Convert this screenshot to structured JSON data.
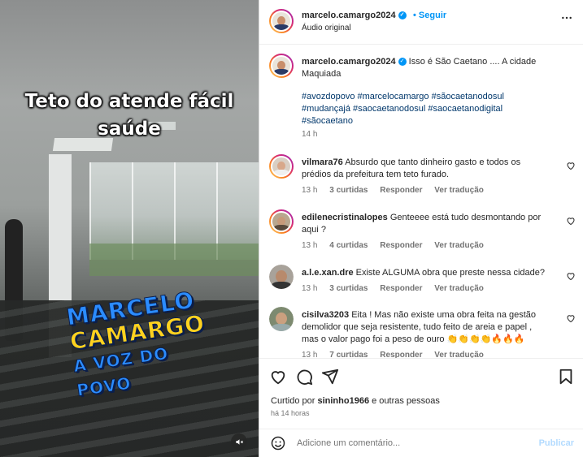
{
  "media": {
    "caption_line1": "Teto do atende fácil",
    "caption_line2": "saúde",
    "logo_line1": "MARCELO",
    "logo_line2": "CAMARGO",
    "logo_line3": "A VOZ DO POVO",
    "mute_icon": "muted-speaker-icon"
  },
  "header": {
    "username": "marcelo.camargo2024",
    "follow_separator": "•",
    "follow_label": "Seguir",
    "subtitle": "Áudio original",
    "more_label": "•••"
  },
  "caption": {
    "username": "marcelo.camargo2024",
    "text": "Isso é São Caetano .... A cidade Maquiada",
    "hashtags": "#avozdopovo #marcelocamargo #sãocaetanodosul #mudançajá #saocaetanodosul #saocaetanodigital #sãocaetano",
    "time": "14 h"
  },
  "comments": [
    {
      "username": "vilmara76",
      "text": "Absurdo que tanto dinheiro gasto e todos os prédios da prefeitura tem teto furado.",
      "time": "13 h",
      "likes": "3 curtidas",
      "reply": "Responder",
      "translate": "Ver tradução"
    },
    {
      "username": "edilenecristinalopes",
      "text": "Genteeee está tudo desmontando por aqui ?",
      "time": "13 h",
      "likes": "4 curtidas",
      "reply": "Responder",
      "translate": "Ver tradução"
    },
    {
      "username": "a.l.e.xan.dre",
      "text": "Existe ALGUMA obra que preste nessa cidade?",
      "time": "13 h",
      "likes": "3 curtidas",
      "reply": "Responder",
      "translate": "Ver tradução"
    },
    {
      "username": "cisilva3203",
      "text": "Eita ! Mas não existe uma obra feita na gestão demolidor que seja resistente, tudo feito de areia e papel , mas o valor pago foi a peso de ouro 👏👏👏👏🔥🔥🔥",
      "time": "13 h",
      "likes": "7 curtidas",
      "reply": "Responder",
      "translate": "Ver tradução"
    }
  ],
  "actions": {
    "liked_by_prefix": "Curtido por",
    "liked_by_user": "sininho1966",
    "liked_by_suffix": "e outras pessoas",
    "ago": "há 14 horas"
  },
  "add_comment": {
    "placeholder": "Adicione um comentário...",
    "publish_label": "Publicar"
  },
  "colors": {
    "accent": "#0095f6",
    "hashtag": "#00376b",
    "muted": "#737373"
  }
}
